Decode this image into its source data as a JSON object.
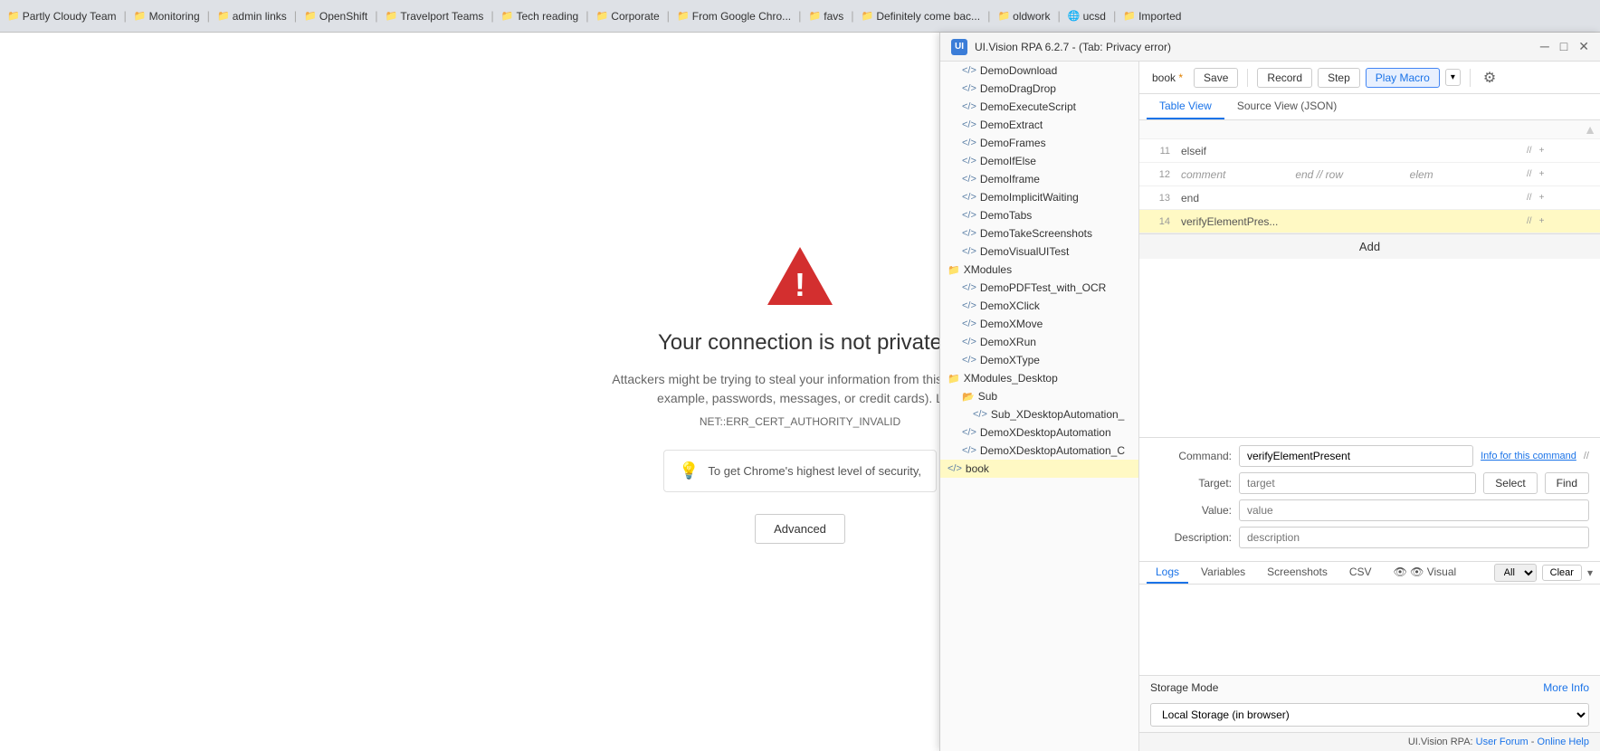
{
  "browser": {
    "bookmarks": [
      {
        "label": "Partly Cloudy Team",
        "icon": "📁"
      },
      {
        "label": "Monitoring",
        "icon": "📁"
      },
      {
        "label": "admin links",
        "icon": "📁"
      },
      {
        "label": "OpenShift",
        "icon": "📁"
      },
      {
        "label": "Travelport Teams",
        "icon": "📁"
      },
      {
        "label": "Tech reading",
        "icon": "📁"
      },
      {
        "label": "Corporate",
        "icon": "📁"
      },
      {
        "label": "From Google Chro...",
        "icon": "📁"
      },
      {
        "label": "favs",
        "icon": "📁"
      },
      {
        "label": "Definitely come bac...",
        "icon": "📁"
      },
      {
        "label": "oldwork",
        "icon": "📁"
      },
      {
        "label": "ucsd",
        "icon": "🌐"
      },
      {
        "label": "Imported",
        "icon": "📁"
      }
    ]
  },
  "error_page": {
    "title": "Your connection is not private",
    "description": "Attackers might be trying to steal your information from this site (for example, passwords, messages, or credit cards). L",
    "code": "NET::ERR_CERT_AUTHORITY_INVALID",
    "security_tip": "To get Chrome's highest level of security,",
    "advanced_btn": "Advanced"
  },
  "uivision": {
    "titlebar": {
      "title": "UI.Vision RPA 6.2.7 - (Tab: Privacy error)",
      "logo": "UI"
    },
    "toolbar": {
      "tab_label": "book",
      "dirty": "*",
      "save_btn": "Save",
      "record_btn": "Record",
      "step_btn": "Step",
      "play_macro_btn": "Play Macro",
      "settings_icon": "⚙"
    },
    "view_tabs": [
      {
        "label": "Table View",
        "active": true
      },
      {
        "label": "Source View (JSON)",
        "active": false
      }
    ],
    "table": {
      "rows": [
        {
          "num": "11",
          "command": "elseif",
          "target": "",
          "value": "",
          "comment": "// ",
          "highlighted": false
        },
        {
          "num": "12",
          "command": "comment",
          "target": "end // row",
          "value": "",
          "comment": "elem",
          "comment2": "// ",
          "highlighted": false
        },
        {
          "num": "13",
          "command": "end",
          "target": "",
          "value": "",
          "comment": "// ",
          "highlighted": false
        },
        {
          "num": "14",
          "command": "verifyElementPres...",
          "target": "",
          "value": "",
          "comment": "// ",
          "highlighted": true
        }
      ],
      "add_btn": "Add"
    },
    "command_editor": {
      "command_label": "Command:",
      "command_value": "verifyElementPresent",
      "info_link": "Info for this command",
      "comment_icon": "//",
      "target_label": "Target:",
      "target_placeholder": "target",
      "select_btn": "Select",
      "find_btn": "Find",
      "value_label": "Value:",
      "value_placeholder": "value",
      "description_label": "Description:",
      "description_placeholder": "description"
    },
    "bottom_panel": {
      "tabs": [
        {
          "label": "Logs",
          "active": true
        },
        {
          "label": "Variables",
          "active": false
        },
        {
          "label": "Screenshots",
          "active": false
        },
        {
          "label": "CSV",
          "active": false
        },
        {
          "label": "👁 Visual",
          "active": false
        }
      ],
      "filter": "All",
      "clear_btn": "Clear"
    },
    "file_tree": {
      "items": [
        {
          "label": "DemoDownload",
          "type": "code",
          "indent": 1
        },
        {
          "label": "DemoDragDrop",
          "type": "code",
          "indent": 1
        },
        {
          "label": "DemoExecuteScript",
          "type": "code",
          "indent": 1
        },
        {
          "label": "DemoExtract",
          "type": "code",
          "indent": 1
        },
        {
          "label": "DemoFrames",
          "type": "code",
          "indent": 1
        },
        {
          "label": "DemoIfElse",
          "type": "code",
          "indent": 1
        },
        {
          "label": "DemoIframe",
          "type": "code",
          "indent": 1
        },
        {
          "label": "DemoImplicitWaiting",
          "type": "code",
          "indent": 1
        },
        {
          "label": "DemoTabs",
          "type": "code",
          "indent": 1
        },
        {
          "label": "DemoTakeScreenshots",
          "type": "code",
          "indent": 1
        },
        {
          "label": "DemoVisualUITest",
          "type": "code",
          "indent": 1
        },
        {
          "label": "XModules",
          "type": "folder",
          "indent": 0
        },
        {
          "label": "DemoPDFTest_with_OCR",
          "type": "code",
          "indent": 1
        },
        {
          "label": "DemoXClick",
          "type": "code",
          "indent": 1
        },
        {
          "label": "DemoXMove",
          "type": "code",
          "indent": 1
        },
        {
          "label": "DemoXRun",
          "type": "code",
          "indent": 1
        },
        {
          "label": "DemoXType",
          "type": "code",
          "indent": 1
        },
        {
          "label": "XModules_Desktop",
          "type": "folder",
          "indent": 0
        },
        {
          "label": "Sub",
          "type": "folder-open",
          "indent": 1
        },
        {
          "label": "Sub_XDesktopAutomation_",
          "type": "code",
          "indent": 2
        },
        {
          "label": "DemoXDesktopAutomation",
          "type": "code",
          "indent": 1
        },
        {
          "label": "DemoXDesktopAutomation_C",
          "type": "code",
          "indent": 1
        },
        {
          "label": "book",
          "type": "code",
          "indent": 0,
          "selected": true
        }
      ]
    },
    "storage": {
      "label": "Storage Mode",
      "more_info": "More Info",
      "options": [
        "Local Storage (in browser)"
      ],
      "selected": "Local Storage (in browser)"
    },
    "footer": {
      "text": "UI.Vision RPA: ",
      "user_forum": "User Forum",
      "separator": " - ",
      "online_help": "Online Help"
    }
  }
}
